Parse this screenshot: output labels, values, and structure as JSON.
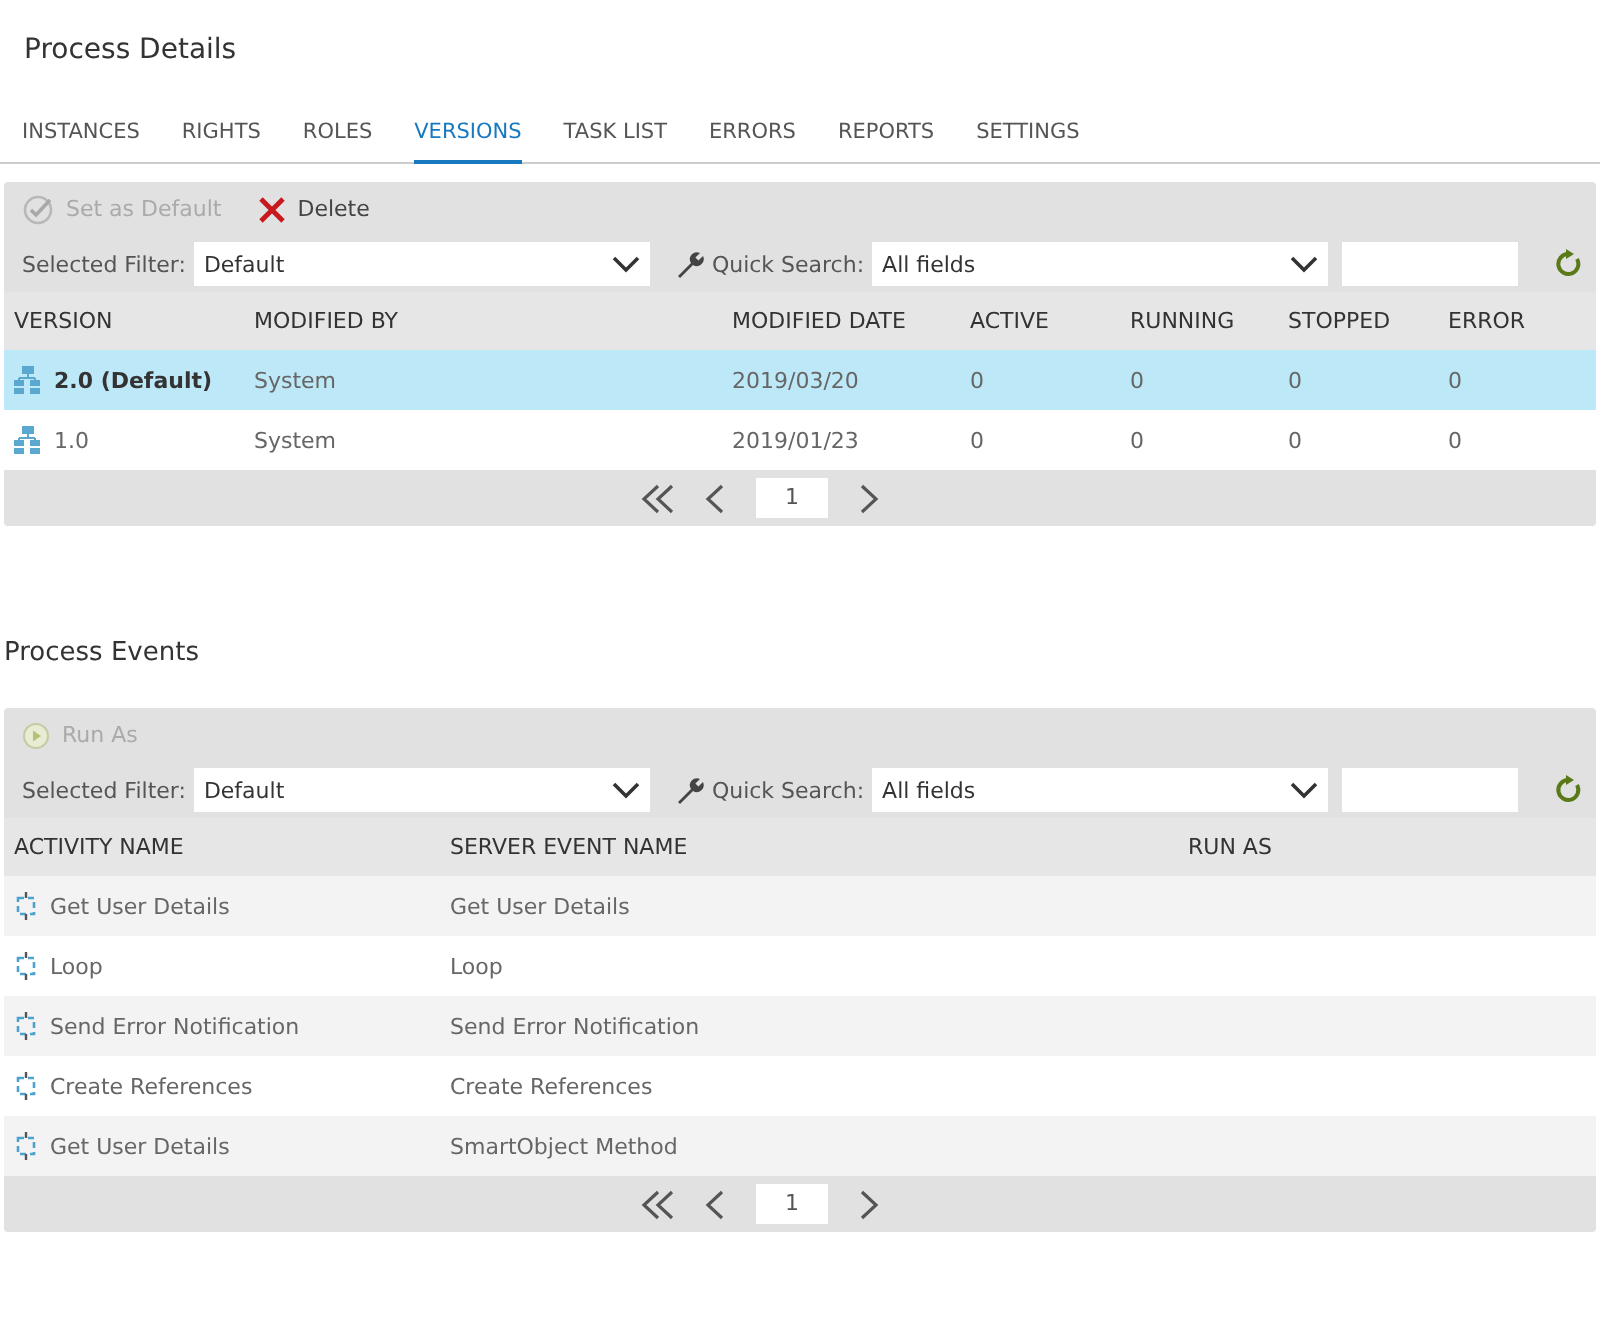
{
  "title": "Process Details",
  "tabs": [
    {
      "label": "INSTANCES",
      "selected": false
    },
    {
      "label": "RIGHTS",
      "selected": false
    },
    {
      "label": "ROLES",
      "selected": false
    },
    {
      "label": "VERSIONS",
      "selected": true
    },
    {
      "label": "TASK LIST",
      "selected": false
    },
    {
      "label": "ERRORS",
      "selected": false
    },
    {
      "label": "REPORTS",
      "selected": false
    },
    {
      "label": "SETTINGS",
      "selected": false
    }
  ],
  "sections": [
    {
      "kind": "versions",
      "actions": [
        {
          "kind": "set-default",
          "label": "Set as Default",
          "disabled": true
        },
        {
          "kind": "delete",
          "label": "Delete",
          "disabled": false
        }
      ],
      "filter_label": "Selected Filter:",
      "filter_value": "Default",
      "search_label": "Quick Search:",
      "search_field": "All fields",
      "columns": [
        "VERSION",
        "MODIFIED BY",
        "MODIFIED DATE",
        "ACTIVE",
        "RUNNING",
        "STOPPED",
        "ERROR"
      ],
      "rows": [
        {
          "selected": true,
          "cells": [
            "2.0 (Default)",
            "System",
            "2019/03/20",
            "0",
            "0",
            "0",
            "0"
          ]
        },
        {
          "selected": false,
          "cells": [
            "1.0",
            "System",
            "2019/01/23",
            "0",
            "0",
            "0",
            "0"
          ]
        }
      ],
      "page": "1"
    },
    {
      "kind": "events",
      "heading": "Process Events",
      "actions": [
        {
          "kind": "run",
          "label": "Run As",
          "disabled": true
        }
      ],
      "filter_label": "Selected Filter:",
      "filter_value": "Default",
      "search_label": "Quick Search:",
      "search_field": "All fields",
      "columns": [
        "ACTIVITY NAME",
        "SERVER EVENT NAME",
        "RUN AS"
      ],
      "rows": [
        {
          "selected": false,
          "cells": [
            "Get User Details",
            "Get User Details"
          ]
        },
        {
          "selected": false,
          "cells": [
            "Loop",
            "Loop"
          ]
        },
        {
          "selected": false,
          "cells": [
            "Send Error Notification",
            "Send Error Notification"
          ]
        },
        {
          "selected": false,
          "cells": [
            "Create References",
            "Create References"
          ]
        },
        {
          "selected": false,
          "cells": [
            "Get User Details",
            "SmartObject Method"
          ]
        }
      ],
      "page": "1"
    }
  ]
}
